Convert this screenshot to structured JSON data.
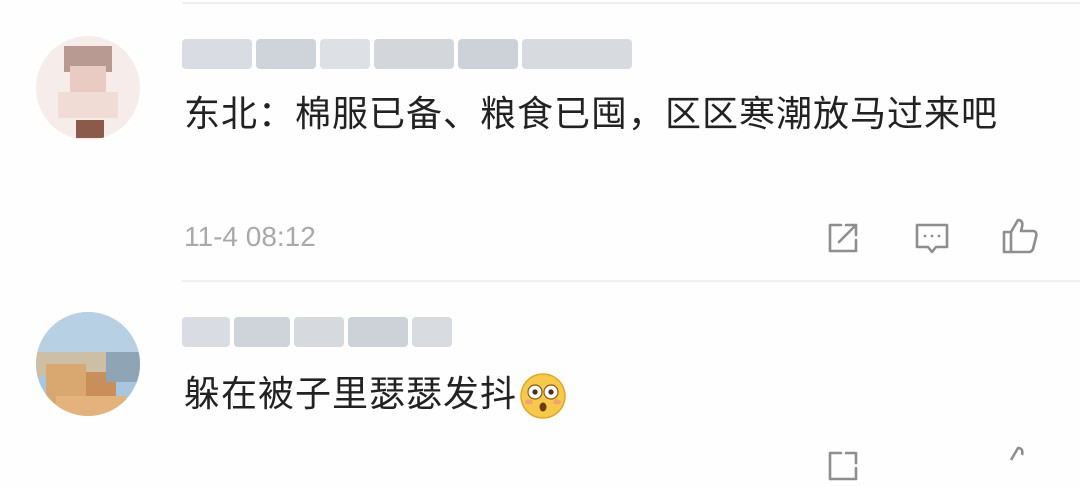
{
  "comments": [
    {
      "username": "",
      "text": "东北：棉服已备、粮食已囤，区区寒潮放马过来吧",
      "time": "11-4 08:12",
      "actions": [
        "share-icon",
        "reply-icon",
        "like-icon"
      ]
    },
    {
      "username": "",
      "text": "躲在被子里瑟瑟发抖",
      "emoji": "flushed-face-emoji",
      "time": "",
      "actions": [
        "share-icon",
        "reply-icon",
        "like-icon"
      ]
    }
  ],
  "colors": {
    "text": "#222222",
    "time": "#a9a9a9",
    "icon": "#8e8e8e",
    "divider": "#f0f0f0"
  }
}
